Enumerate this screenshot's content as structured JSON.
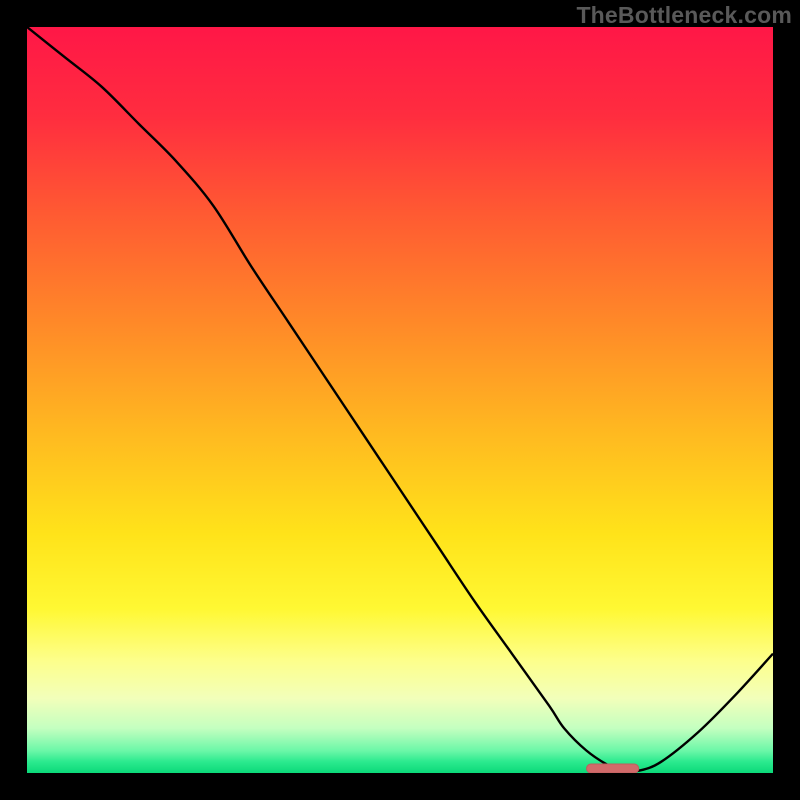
{
  "watermark": "TheBottleneck.com",
  "colors": {
    "frame": "#000000",
    "gradient_stops": [
      {
        "offset": 0.0,
        "color": "#ff1747"
      },
      {
        "offset": 0.12,
        "color": "#ff2d3f"
      },
      {
        "offset": 0.25,
        "color": "#ff5a32"
      },
      {
        "offset": 0.4,
        "color": "#ff8a28"
      },
      {
        "offset": 0.55,
        "color": "#ffbb20"
      },
      {
        "offset": 0.68,
        "color": "#ffe31a"
      },
      {
        "offset": 0.78,
        "color": "#fff833"
      },
      {
        "offset": 0.85,
        "color": "#fdff8c"
      },
      {
        "offset": 0.9,
        "color": "#f2ffba"
      },
      {
        "offset": 0.94,
        "color": "#c4ffc0"
      },
      {
        "offset": 0.97,
        "color": "#6cf7a8"
      },
      {
        "offset": 0.985,
        "color": "#2bea8e"
      },
      {
        "offset": 1.0,
        "color": "#0bd979"
      }
    ],
    "curve": "#000000",
    "marker_fill": "#d16a6a",
    "marker_stroke": "#bd5f5f"
  },
  "chart_data": {
    "type": "line",
    "title": "",
    "xlabel": "",
    "ylabel": "",
    "xlim": [
      0,
      100
    ],
    "ylim": [
      0,
      100
    ],
    "x": [
      0,
      5,
      10,
      15,
      20,
      25,
      30,
      35,
      40,
      45,
      50,
      55,
      60,
      65,
      70,
      72,
      75,
      78,
      80,
      82,
      85,
      90,
      95,
      100
    ],
    "values": [
      100,
      96,
      92,
      87,
      82,
      76,
      68,
      60.5,
      53,
      45.5,
      38,
      30.5,
      23,
      16,
      9,
      6,
      3,
      1,
      0.3,
      0.3,
      1.5,
      5.5,
      10.5,
      16
    ],
    "marker": {
      "x_start": 75,
      "x_end": 82,
      "y": 0.6
    },
    "notes": "x is a normalized horizontal coordinate (0=left edge of plot, 100=right). values is a normalized vertical metric (0=bottom/green, 100=top/red). The curve starts at the top-left, descends steeply with a slight knee around x≈25, bottoms out near x≈80, and rises again toward the right."
  }
}
